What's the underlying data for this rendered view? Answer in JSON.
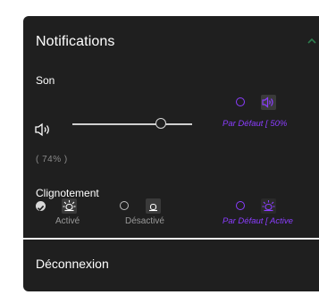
{
  "panel": {
    "title": "Notifications",
    "sound": {
      "label": "Son",
      "volume_percent": 74,
      "percent_text": "( 74% )",
      "default_label": "Par Défaut [ 50%"
    },
    "blink": {
      "label": "Clignotement",
      "options": [
        {
          "label": "Activé",
          "selected": true,
          "icon": "siren-on-icon"
        },
        {
          "label": "Désactivé",
          "selected": false,
          "icon": "siren-off-icon"
        }
      ],
      "default_label": "Par Défaut [ Active"
    },
    "logout_label": "Déconnexion"
  },
  "colors": {
    "panel_bg": "#1f1f1f",
    "accent_purple": "#8b3dff",
    "chevron_green": "#2e7d4f"
  }
}
